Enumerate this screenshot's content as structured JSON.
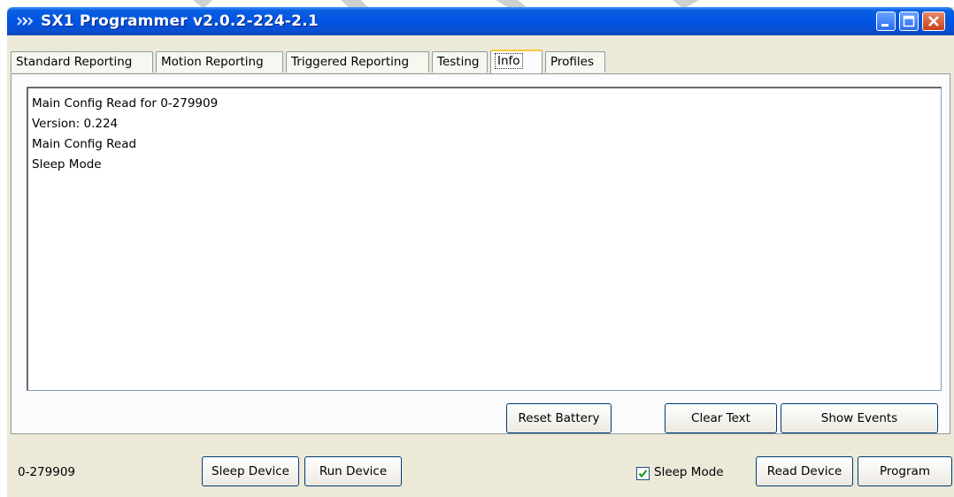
{
  "window": {
    "title": "SX1 Programmer v2.0.2-224-2.1"
  },
  "tabs": [
    {
      "label": "Standard Reporting"
    },
    {
      "label": "Motion Reporting"
    },
    {
      "label": "Triggered Reporting"
    },
    {
      "label": "Testing"
    },
    {
      "label": "Info",
      "active": true
    },
    {
      "label": "Profiles"
    }
  ],
  "info": {
    "lines": [
      "Main Config Read for 0-279909",
      "Version: 0.224",
      "Main Config Read",
      "Sleep Mode"
    ],
    "reset_battery_label": "Reset Battery",
    "clear_text_label": "Clear Text",
    "show_events_label": "Show Events"
  },
  "status": {
    "device_id": "0-279909",
    "sleep_device_label": "Sleep Device",
    "run_device_label": "Run Device",
    "sleep_mode_label": "Sleep Mode",
    "sleep_mode_checked": true,
    "read_device_label": "Read Device",
    "program_label": "Program"
  },
  "colors": {
    "titlebar": "#0054e3",
    "window_bg": "#ece9d8",
    "active_tab_accent": "#ffc83c",
    "button_border": "#003c74",
    "check_mark": "#21a121"
  },
  "icons": {
    "app": "chevron-arrows-icon",
    "minimize": "minimize-icon",
    "maximize": "maximize-icon",
    "close": "close-icon",
    "check": "checkmark-icon"
  }
}
